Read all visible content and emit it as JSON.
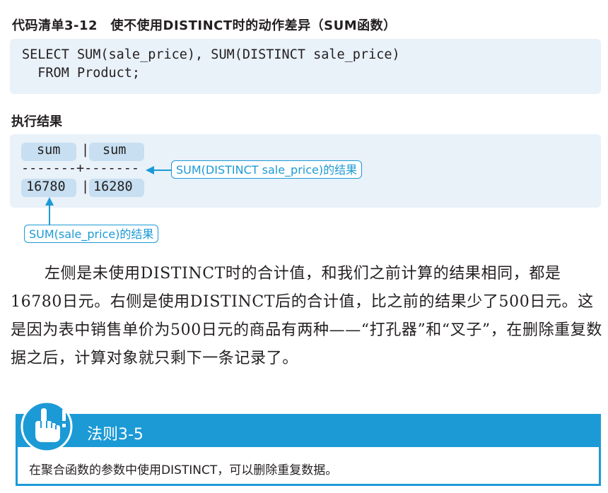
{
  "listing": {
    "title": "代码清单3-12　使不使用DISTINCT时的动作差异（SUM函数）",
    "code_lines": [
      "SELECT SUM(sale_price), SUM(DISTINCT sale_price)",
      "  FROM Product;"
    ]
  },
  "result": {
    "label": "执行结果",
    "col1_header": "sum",
    "col2_header": "sum",
    "header_sep": "|",
    "divider": "-------+-------",
    "col1_value": "16780",
    "col2_value": "16280",
    "row_sep": "|",
    "callout_distinct": "SUM(DISTINCT sale_price)的结果",
    "callout_plain": "SUM(sale_price)的结果",
    "accent_color": "#1c9ad6",
    "highlight_color": "#c7dff1"
  },
  "paragraph": {
    "text": "左侧是未使用DISTINCT时的合计值，和我们之前计算的结果相同，都是16780日元。右侧是使用DISTINCT后的合计值，比之前的结果少了500日元。这是因为表中销售单价为500日元的商品有两种——“打孔器”和“叉子”，在删除重复数据之后，计算对象就只剩下一条记录了。"
  },
  "rule": {
    "title": "法则3-5",
    "body": "在聚合函数的参数中使用DISTINCT，可以删除重复数据。",
    "icon": "pointing-hand-icon"
  }
}
